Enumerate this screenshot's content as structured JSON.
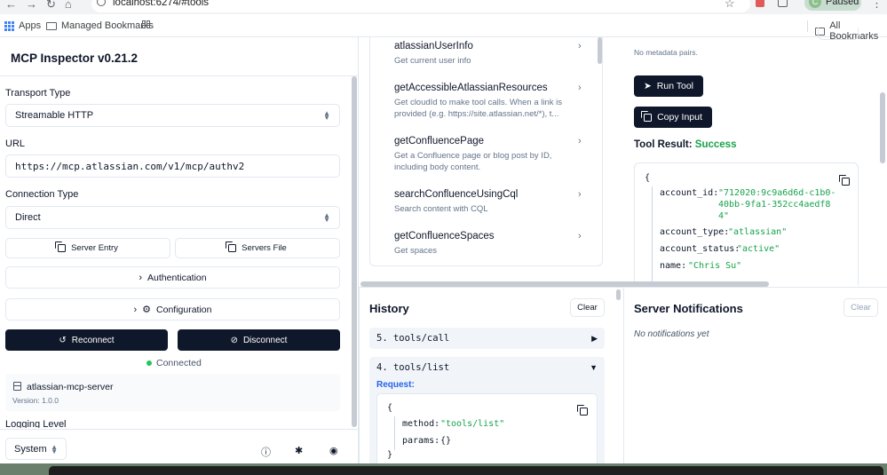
{
  "browser": {
    "url": "localhost:6274/#tools",
    "profile_label": "Paused",
    "profile_initial": "C",
    "bookmarks": [
      "Apps",
      "Managed Bookmarks"
    ],
    "all_bookmarks": "All Bookmarks"
  },
  "sidebar": {
    "title": "MCP Inspector v0.21.2",
    "transport_label": "Transport Type",
    "transport_value": "Streamable HTTP",
    "url_label": "URL",
    "url_value": "https://mcp.atlassian.com/v1/mcp/authv2",
    "connection_label": "Connection Type",
    "connection_value": "Direct",
    "server_entry": "Server Entry",
    "servers_file": "Servers File",
    "authentication": "Authentication",
    "configuration": "Configuration",
    "reconnect": "Reconnect",
    "disconnect": "Disconnect",
    "status": "Connected",
    "server_name": "atlassian-mcp-server",
    "server_version": "Version: 1.0.0",
    "logging_label": "Logging Level",
    "theme_value": "System"
  },
  "tools": [
    {
      "name": "atlassianUserInfo",
      "desc": "Get current user info"
    },
    {
      "name": "getAccessibleAtlassianResources",
      "desc": "Get cloudId to make tool calls. When a link is provided (e.g. https://site.atlassian.net/*), t..."
    },
    {
      "name": "getConfluencePage",
      "desc": "Get a Confluence page or blog post by ID, including body content."
    },
    {
      "name": "searchConfluenceUsingCql",
      "desc": "Search content with CQL"
    },
    {
      "name": "getConfluenceSpaces",
      "desc": "Get spaces"
    }
  ],
  "result": {
    "metadata_text": "No metadata pairs.",
    "run_tool": "Run Tool",
    "copy_input": "Copy Input",
    "label": "Tool Result:",
    "status": "Success",
    "json_open": "{",
    "account_id_key": "account_id:",
    "account_id_val_1": "\"712020:9c9a6d6d-c1b0-",
    "account_id_val_2": "40bb-9fa1-352cc4aedf8",
    "account_id_val_3": "4\"",
    "account_type_key": "account_type:",
    "account_type_val": "\"atlassian\"",
    "account_status_key": "account_status:",
    "account_status_val": "\"active\"",
    "name_key": "name:",
    "name_val": "\"Chris Su\""
  },
  "history": {
    "title": "History",
    "clear": "Clear",
    "items": [
      {
        "label": "5. tools/call",
        "arrow": "▶"
      },
      {
        "label": "4. tools/list",
        "arrow": "▼"
      }
    ],
    "request_label": "Request:",
    "json_open": "{",
    "method_key": "method:",
    "method_val": "\"tools/list\"",
    "params_key": "params:",
    "params_val": "{}",
    "json_close": "}"
  },
  "notifications": {
    "title": "Server Notifications",
    "clear": "Clear",
    "empty": "No notifications yet"
  }
}
